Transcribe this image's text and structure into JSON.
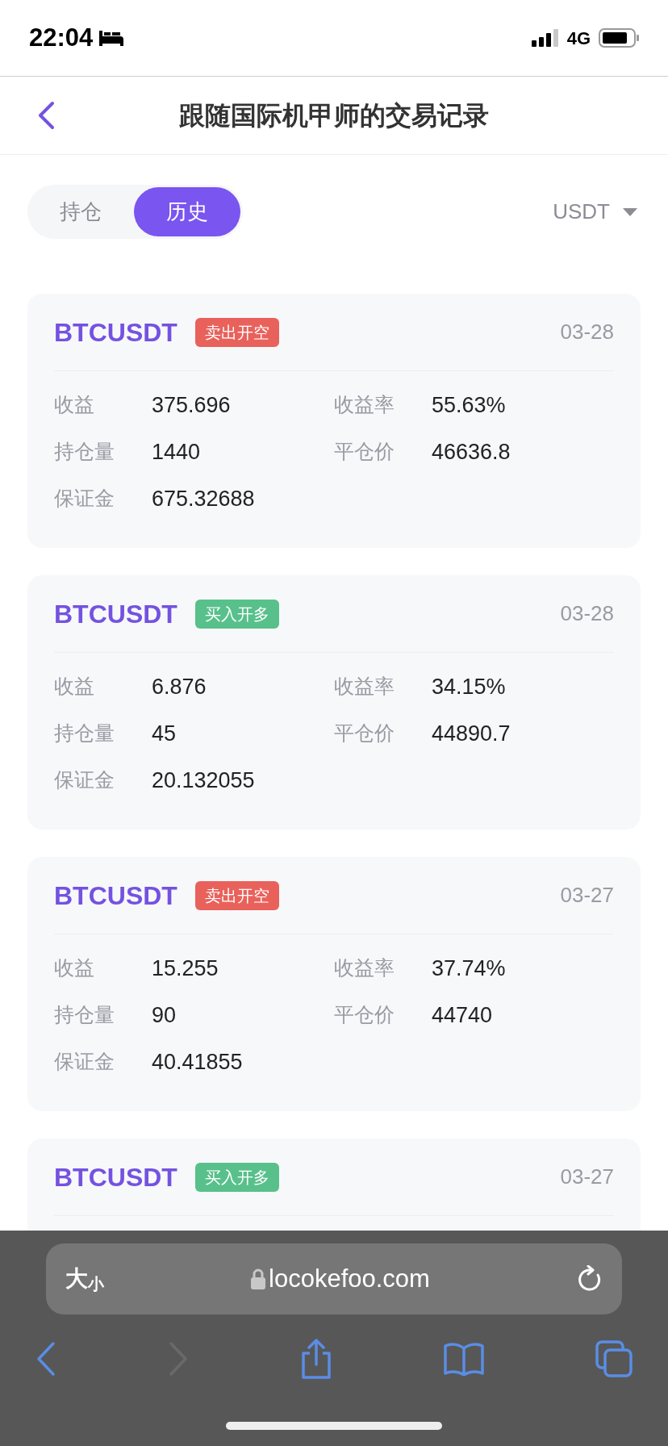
{
  "status_bar": {
    "time": "22:04",
    "network": "4G"
  },
  "header": {
    "title": "跟随国际机甲师的交易记录"
  },
  "tabs": [
    {
      "label": "持仓",
      "selected": false
    },
    {
      "label": "历史",
      "selected": true
    }
  ],
  "currency": {
    "label": "USDT"
  },
  "trades": [
    {
      "symbol": "BTCUSDT",
      "tag": "卖出开空",
      "kind": "sell",
      "date": "03-28",
      "fields": [
        {
          "label": "收益",
          "value": "375.696"
        },
        {
          "label": "收益率",
          "value": "55.63%"
        },
        {
          "label": "持仓量",
          "value": "1440"
        },
        {
          "label": "平仓价",
          "value": "46636.8"
        },
        {
          "label": "保证金",
          "value": "675.32688"
        }
      ]
    },
    {
      "symbol": "BTCUSDT",
      "tag": "买入开多",
      "kind": "buy",
      "date": "03-28",
      "fields": [
        {
          "label": "收益",
          "value": "6.876"
        },
        {
          "label": "收益率",
          "value": "34.15%"
        },
        {
          "label": "持仓量",
          "value": "45"
        },
        {
          "label": "平仓价",
          "value": "44890.7"
        },
        {
          "label": "保证金",
          "value": "20.132055"
        }
      ]
    },
    {
      "symbol": "BTCUSDT",
      "tag": "卖出开空",
      "kind": "sell",
      "date": "03-27",
      "fields": [
        {
          "label": "收益",
          "value": "15.255"
        },
        {
          "label": "收益率",
          "value": "37.74%"
        },
        {
          "label": "持仓量",
          "value": "90"
        },
        {
          "label": "平仓价",
          "value": "44740"
        },
        {
          "label": "保证金",
          "value": "40.41855"
        }
      ]
    },
    {
      "symbol": "BTCUSDT",
      "tag": "买入开多",
      "kind": "buy",
      "date": "03-27"
    }
  ],
  "browser": {
    "text_size": "大",
    "text_size_small": "小",
    "url": "locokefoo.com",
    "forward_disabled": true
  }
}
